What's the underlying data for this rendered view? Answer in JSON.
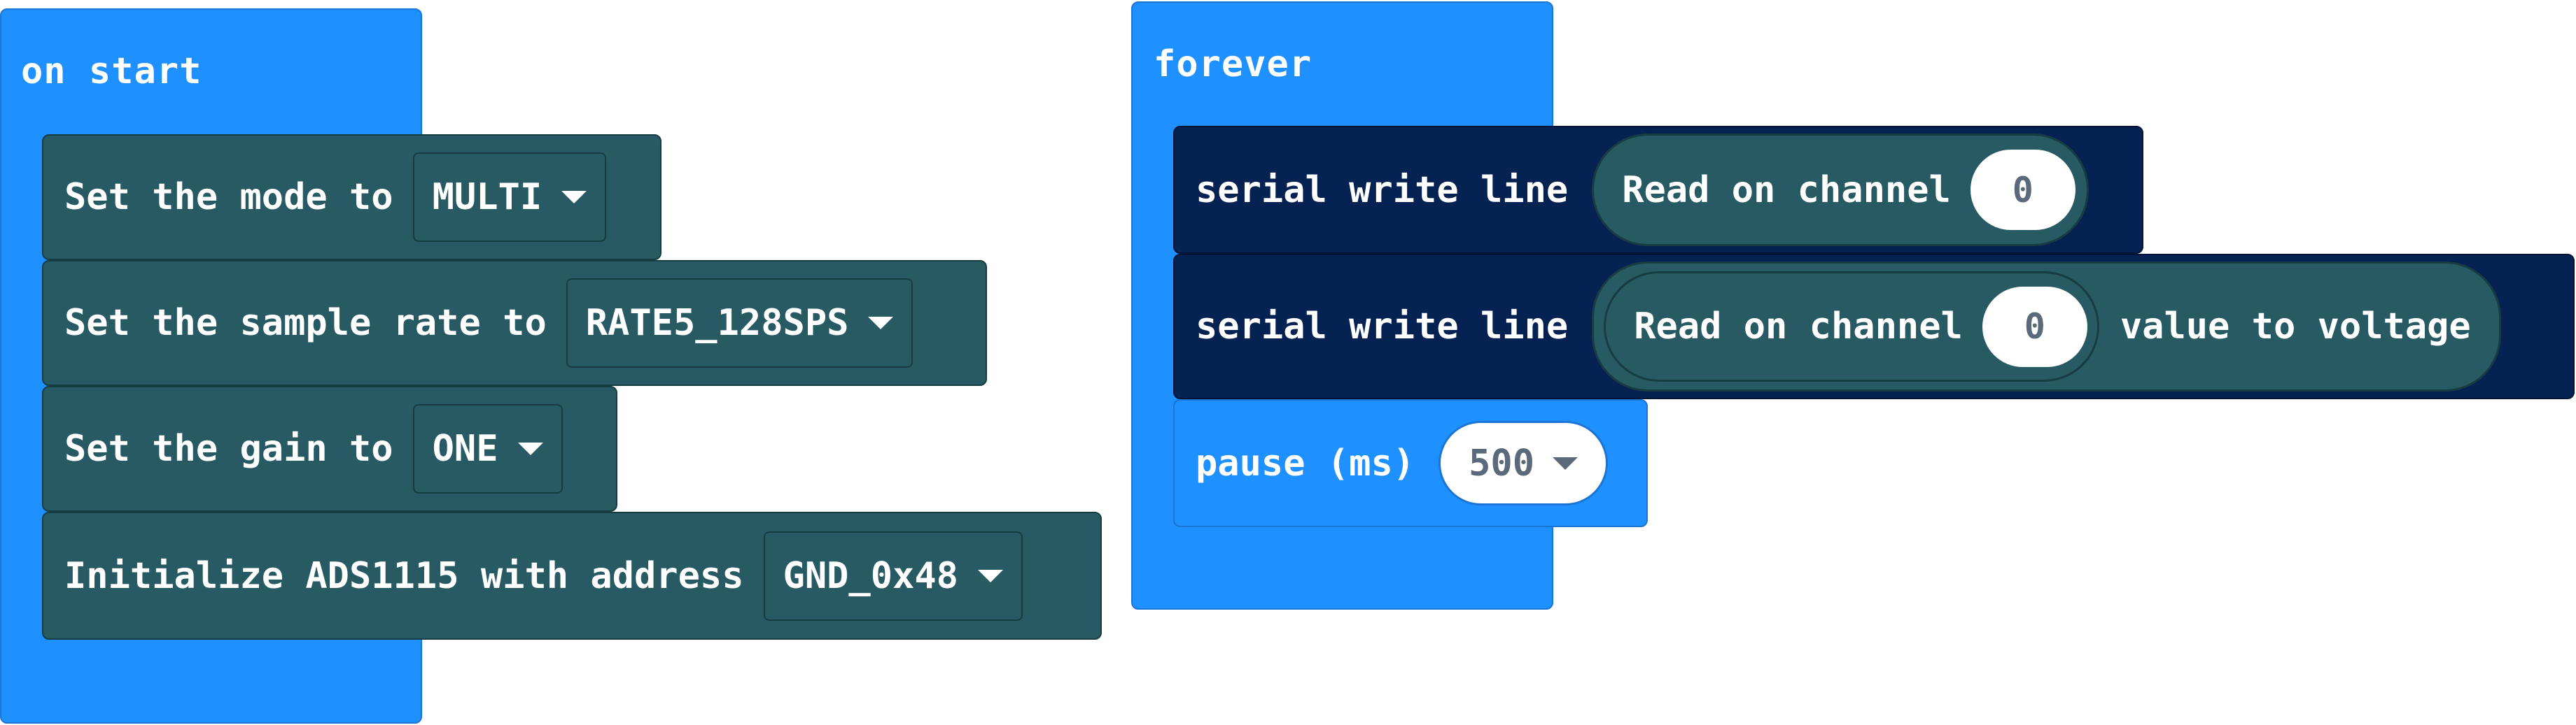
{
  "on_start": {
    "title": "on start",
    "blocks": [
      {
        "label": "Set the mode to",
        "value": "MULTI"
      },
      {
        "label": "Set the sample rate to",
        "value": "RATE5_128SPS"
      },
      {
        "label": "Set the gain to",
        "value": "ONE"
      },
      {
        "label": "Initialize ADS1115 with address",
        "value": "GND_0x48"
      }
    ]
  },
  "forever": {
    "title": "forever",
    "serial1": {
      "label": "serial write line",
      "reporter": "Read on channel",
      "channel": "0"
    },
    "serial2": {
      "label": "serial write line",
      "reporter": "Read on channel",
      "channel": "0",
      "suffix": "value to voltage"
    },
    "pause": {
      "label": "pause (ms)",
      "value": "500"
    }
  },
  "colors": {
    "event_blue": "#1e90ff",
    "ads_teal": "#275a63",
    "serial_navy": "#062253"
  }
}
